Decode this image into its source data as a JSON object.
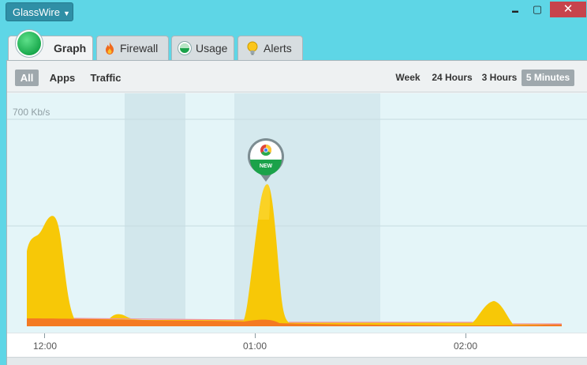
{
  "app": {
    "menu_label": "GlassWire"
  },
  "window": {
    "minimize": "▬",
    "maximize": "▢",
    "close": "✕"
  },
  "tabs": [
    {
      "label": "Graph",
      "icon": "graph-orb-icon",
      "active": true
    },
    {
      "label": "Firewall",
      "icon": "fire-icon"
    },
    {
      "label": "Usage",
      "icon": "usage-pie-icon"
    },
    {
      "label": "Alerts",
      "icon": "bulb-icon"
    }
  ],
  "toolbar": {
    "left": [
      "All",
      "Apps",
      "Traffic"
    ],
    "right": [
      "Week",
      "24 Hours",
      "3 Hours",
      "5 Minutes"
    ],
    "selected_left": "All",
    "selected_right": "5 Minutes"
  },
  "graph": {
    "scale_label": "700 Kb/s",
    "marker_badge": "NEW",
    "marker_app_icon": "chrome-icon",
    "time_labels": [
      "12:00",
      "01:00",
      "02:00"
    ],
    "colors": {
      "incoming": "#f7c807",
      "outgoing": "#f47a22",
      "accent": "#1ba24a"
    }
  }
}
